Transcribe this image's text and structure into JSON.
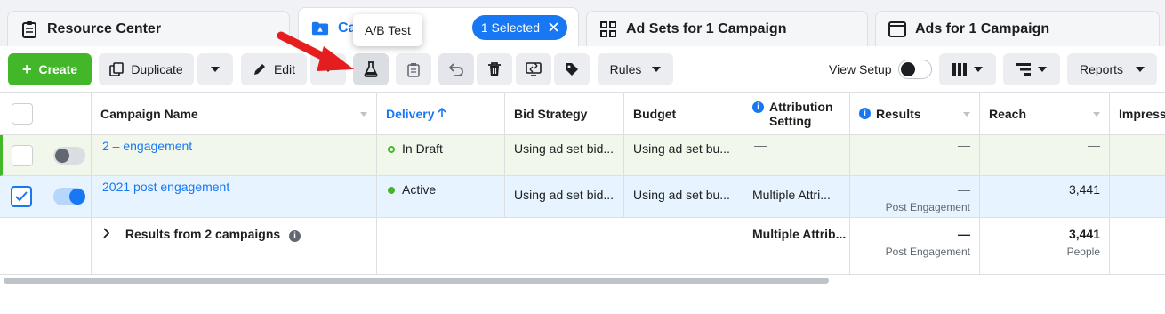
{
  "tabs": {
    "resource_center": "Resource Center",
    "campaigns": "Ca",
    "selected_badge": "1 Selected",
    "ad_sets": "Ad Sets for 1 Campaign",
    "ads": "Ads for 1 Campaign"
  },
  "tooltip": "A/B Test",
  "toolbar": {
    "create": "Create",
    "duplicate": "Duplicate",
    "edit": "Edit",
    "rules": "Rules",
    "view_setup": "View Setup",
    "reports": "Reports"
  },
  "table": {
    "headers": {
      "campaign_name": "Campaign Name",
      "delivery": "Delivery",
      "bid_strategy": "Bid Strategy",
      "budget": "Budget",
      "attribution": "Attribution Setting",
      "results": "Results",
      "reach": "Reach",
      "impressions": "Impress"
    },
    "rows": [
      {
        "name": "2 – engagement",
        "delivery": "In Draft",
        "bid_strategy": "Using ad set bid...",
        "budget": "Using ad set bu...",
        "attribution": "—",
        "results": "—",
        "reach": "—",
        "on": false,
        "checked": false
      },
      {
        "name": "2021 post engagement",
        "delivery": "Active",
        "bid_strategy": "Using ad set bid...",
        "budget": "Using ad set bu...",
        "attribution": "Multiple Attri...",
        "results": "—",
        "results_sub": "Post Engagement",
        "reach": "3,441",
        "on": true,
        "checked": true
      }
    ],
    "summary": {
      "label": "Results from 2 campaigns",
      "attribution": "Multiple Attrib...",
      "results": "—",
      "results_sub": "Post Engagement",
      "reach": "3,441",
      "reach_sub": "People"
    }
  },
  "colors": {
    "primary": "#1877f2",
    "create_green": "#42b72a",
    "draft_green": "#42b72a",
    "active_green": "#42b72a",
    "arrow_red": "#e41e1e"
  }
}
